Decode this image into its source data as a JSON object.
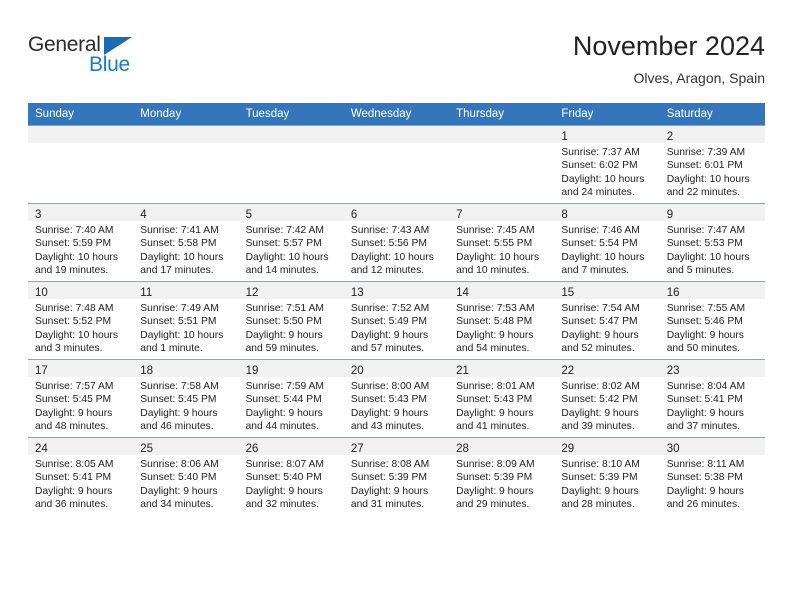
{
  "brand": {
    "name_part1": "General",
    "name_part2": "Blue",
    "color_dark": "#2b2b2b",
    "color_blue": "#2079c8",
    "triangle_color": "#1b6cb5"
  },
  "header": {
    "title": "November 2024",
    "subtitle": "Olves, Aragon, Spain"
  },
  "theme": {
    "header_row_bg": "#3576ba",
    "header_row_text": "#ffffff",
    "daynum_band_bg": "#f1f1f1",
    "cell_border": "#9aa0a6",
    "text": "#222222"
  },
  "weekdays": [
    "Sunday",
    "Monday",
    "Tuesday",
    "Wednesday",
    "Thursday",
    "Friday",
    "Saturday"
  ],
  "labels": {
    "sunrise_prefix": "Sunrise:",
    "sunset_prefix": "Sunset:",
    "daylight_prefix": "Daylight:"
  },
  "weeks": [
    [
      {
        "day": "",
        "empty": true
      },
      {
        "day": "",
        "empty": true
      },
      {
        "day": "",
        "empty": true
      },
      {
        "day": "",
        "empty": true
      },
      {
        "day": "",
        "empty": true
      },
      {
        "day": "1",
        "sunrise": "Sunrise: 7:37 AM",
        "sunset": "Sunset: 6:02 PM",
        "daylight_l1": "Daylight: 10 hours",
        "daylight_l2": "and 24 minutes."
      },
      {
        "day": "2",
        "sunrise": "Sunrise: 7:39 AM",
        "sunset": "Sunset: 6:01 PM",
        "daylight_l1": "Daylight: 10 hours",
        "daylight_l2": "and 22 minutes."
      }
    ],
    [
      {
        "day": "3",
        "sunrise": "Sunrise: 7:40 AM",
        "sunset": "Sunset: 5:59 PM",
        "daylight_l1": "Daylight: 10 hours",
        "daylight_l2": "and 19 minutes."
      },
      {
        "day": "4",
        "sunrise": "Sunrise: 7:41 AM",
        "sunset": "Sunset: 5:58 PM",
        "daylight_l1": "Daylight: 10 hours",
        "daylight_l2": "and 17 minutes."
      },
      {
        "day": "5",
        "sunrise": "Sunrise: 7:42 AM",
        "sunset": "Sunset: 5:57 PM",
        "daylight_l1": "Daylight: 10 hours",
        "daylight_l2": "and 14 minutes."
      },
      {
        "day": "6",
        "sunrise": "Sunrise: 7:43 AM",
        "sunset": "Sunset: 5:56 PM",
        "daylight_l1": "Daylight: 10 hours",
        "daylight_l2": "and 12 minutes."
      },
      {
        "day": "7",
        "sunrise": "Sunrise: 7:45 AM",
        "sunset": "Sunset: 5:55 PM",
        "daylight_l1": "Daylight: 10 hours",
        "daylight_l2": "and 10 minutes."
      },
      {
        "day": "8",
        "sunrise": "Sunrise: 7:46 AM",
        "sunset": "Sunset: 5:54 PM",
        "daylight_l1": "Daylight: 10 hours",
        "daylight_l2": "and 7 minutes."
      },
      {
        "day": "9",
        "sunrise": "Sunrise: 7:47 AM",
        "sunset": "Sunset: 5:53 PM",
        "daylight_l1": "Daylight: 10 hours",
        "daylight_l2": "and 5 minutes."
      }
    ],
    [
      {
        "day": "10",
        "sunrise": "Sunrise: 7:48 AM",
        "sunset": "Sunset: 5:52 PM",
        "daylight_l1": "Daylight: 10 hours",
        "daylight_l2": "and 3 minutes."
      },
      {
        "day": "11",
        "sunrise": "Sunrise: 7:49 AM",
        "sunset": "Sunset: 5:51 PM",
        "daylight_l1": "Daylight: 10 hours",
        "daylight_l2": "and 1 minute."
      },
      {
        "day": "12",
        "sunrise": "Sunrise: 7:51 AM",
        "sunset": "Sunset: 5:50 PM",
        "daylight_l1": "Daylight: 9 hours",
        "daylight_l2": "and 59 minutes."
      },
      {
        "day": "13",
        "sunrise": "Sunrise: 7:52 AM",
        "sunset": "Sunset: 5:49 PM",
        "daylight_l1": "Daylight: 9 hours",
        "daylight_l2": "and 57 minutes."
      },
      {
        "day": "14",
        "sunrise": "Sunrise: 7:53 AM",
        "sunset": "Sunset: 5:48 PM",
        "daylight_l1": "Daylight: 9 hours",
        "daylight_l2": "and 54 minutes."
      },
      {
        "day": "15",
        "sunrise": "Sunrise: 7:54 AM",
        "sunset": "Sunset: 5:47 PM",
        "daylight_l1": "Daylight: 9 hours",
        "daylight_l2": "and 52 minutes."
      },
      {
        "day": "16",
        "sunrise": "Sunrise: 7:55 AM",
        "sunset": "Sunset: 5:46 PM",
        "daylight_l1": "Daylight: 9 hours",
        "daylight_l2": "and 50 minutes."
      }
    ],
    [
      {
        "day": "17",
        "sunrise": "Sunrise: 7:57 AM",
        "sunset": "Sunset: 5:45 PM",
        "daylight_l1": "Daylight: 9 hours",
        "daylight_l2": "and 48 minutes."
      },
      {
        "day": "18",
        "sunrise": "Sunrise: 7:58 AM",
        "sunset": "Sunset: 5:45 PM",
        "daylight_l1": "Daylight: 9 hours",
        "daylight_l2": "and 46 minutes."
      },
      {
        "day": "19",
        "sunrise": "Sunrise: 7:59 AM",
        "sunset": "Sunset: 5:44 PM",
        "daylight_l1": "Daylight: 9 hours",
        "daylight_l2": "and 44 minutes."
      },
      {
        "day": "20",
        "sunrise": "Sunrise: 8:00 AM",
        "sunset": "Sunset: 5:43 PM",
        "daylight_l1": "Daylight: 9 hours",
        "daylight_l2": "and 43 minutes."
      },
      {
        "day": "21",
        "sunrise": "Sunrise: 8:01 AM",
        "sunset": "Sunset: 5:43 PM",
        "daylight_l1": "Daylight: 9 hours",
        "daylight_l2": "and 41 minutes."
      },
      {
        "day": "22",
        "sunrise": "Sunrise: 8:02 AM",
        "sunset": "Sunset: 5:42 PM",
        "daylight_l1": "Daylight: 9 hours",
        "daylight_l2": "and 39 minutes."
      },
      {
        "day": "23",
        "sunrise": "Sunrise: 8:04 AM",
        "sunset": "Sunset: 5:41 PM",
        "daylight_l1": "Daylight: 9 hours",
        "daylight_l2": "and 37 minutes."
      }
    ],
    [
      {
        "day": "24",
        "sunrise": "Sunrise: 8:05 AM",
        "sunset": "Sunset: 5:41 PM",
        "daylight_l1": "Daylight: 9 hours",
        "daylight_l2": "and 36 minutes."
      },
      {
        "day": "25",
        "sunrise": "Sunrise: 8:06 AM",
        "sunset": "Sunset: 5:40 PM",
        "daylight_l1": "Daylight: 9 hours",
        "daylight_l2": "and 34 minutes."
      },
      {
        "day": "26",
        "sunrise": "Sunrise: 8:07 AM",
        "sunset": "Sunset: 5:40 PM",
        "daylight_l1": "Daylight: 9 hours",
        "daylight_l2": "and 32 minutes."
      },
      {
        "day": "27",
        "sunrise": "Sunrise: 8:08 AM",
        "sunset": "Sunset: 5:39 PM",
        "daylight_l1": "Daylight: 9 hours",
        "daylight_l2": "and 31 minutes."
      },
      {
        "day": "28",
        "sunrise": "Sunrise: 8:09 AM",
        "sunset": "Sunset: 5:39 PM",
        "daylight_l1": "Daylight: 9 hours",
        "daylight_l2": "and 29 minutes."
      },
      {
        "day": "29",
        "sunrise": "Sunrise: 8:10 AM",
        "sunset": "Sunset: 5:39 PM",
        "daylight_l1": "Daylight: 9 hours",
        "daylight_l2": "and 28 minutes."
      },
      {
        "day": "30",
        "sunrise": "Sunrise: 8:11 AM",
        "sunset": "Sunset: 5:38 PM",
        "daylight_l1": "Daylight: 9 hours",
        "daylight_l2": "and 26 minutes."
      }
    ]
  ]
}
